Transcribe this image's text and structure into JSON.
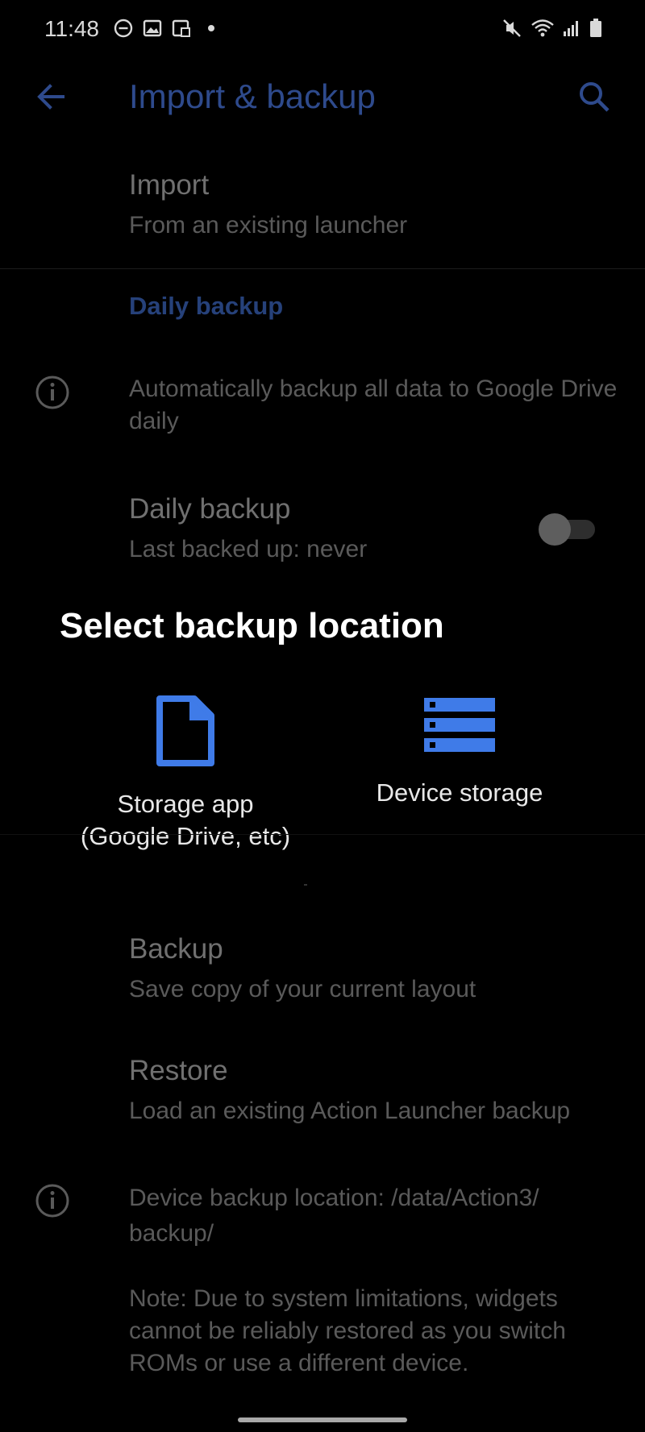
{
  "status_bar": {
    "time": "11:48",
    "left_icons": [
      "do-not-disturb-icon",
      "gallery-icon",
      "screenshot-icon",
      "dot-icon"
    ],
    "right_icons": [
      "mute-icon",
      "wifi-icon",
      "signal-icon",
      "battery-icon"
    ]
  },
  "app_bar": {
    "title": "Import & backup",
    "back_icon": "arrow-back-icon",
    "search_icon": "search-icon"
  },
  "import": {
    "title": "Import",
    "summary": "From an existing launcher"
  },
  "daily_backup_section": {
    "header": "Daily backup",
    "info_text": "Automatically backup all data to Google Drive daily",
    "toggle_title": "Daily backup",
    "toggle_summary": "Last backed up: never",
    "toggle_on": false
  },
  "dialog": {
    "title": "Select backup location",
    "options": [
      {
        "label": "Storage app\n(Google Drive, etc)",
        "icon": "file-icon"
      },
      {
        "label": "Device storage",
        "icon": "storage-icon"
      }
    ]
  },
  "backup": {
    "title": "Backup",
    "summary": "Save copy of your current layout"
  },
  "restore": {
    "title": "Restore",
    "summary": "Load an existing Action Launcher backup"
  },
  "device_info": {
    "location_text": "Device backup location: /data/Action3/ backup/",
    "note_text": "Note: Due to system limitations, widgets cannot be reliably restored as you switch ROMs or use a different device."
  },
  "colors": {
    "accent_dim": "#2e4a8c",
    "dialog_accent": "#3f7be8",
    "background": "#000000"
  }
}
